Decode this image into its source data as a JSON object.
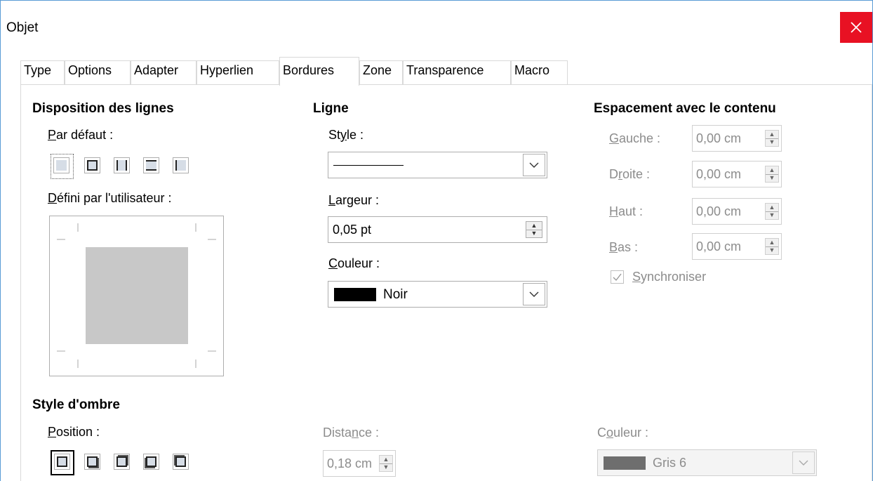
{
  "window": {
    "title": "Objet"
  },
  "tabs": [
    {
      "label": "Type",
      "active": false
    },
    {
      "label": "Options",
      "active": false
    },
    {
      "label": "Adapter",
      "active": false
    },
    {
      "label": "Hyperlien",
      "active": false
    },
    {
      "label": "Bordures",
      "active": true
    },
    {
      "label": "Zone",
      "active": false
    },
    {
      "label": "Transparence",
      "active": false
    },
    {
      "label": "Macro",
      "active": false
    }
  ],
  "line_arrangement": {
    "heading": "Disposition des lignes",
    "presets_label_key": "P",
    "presets_label_rest": "ar défaut :",
    "user_label_key": "D",
    "user_label_rest": "éfini par l'utilisateur :"
  },
  "line": {
    "heading": "Ligne",
    "style_label_pre": "St",
    "style_label_key": "y",
    "style_label_post": "le :",
    "width_label_key": "L",
    "width_label_rest": "argeur :",
    "width_value": "0,05 pt",
    "color_label_key": "C",
    "color_label_rest": "ouleur :",
    "color_value": "Noir",
    "color_swatch": "#000000"
  },
  "padding": {
    "heading": "Espacement avec le contenu",
    "left_label_key": "G",
    "left_label_rest": "auche :",
    "left_value": "0,00 cm",
    "right_label_pre": "D",
    "right_label_key": "r",
    "right_label_post": "oite :",
    "right_value": "0,00 cm",
    "top_label_key": "H",
    "top_label_rest": "aut :",
    "top_value": "0,00 cm",
    "bottom_label_key": "B",
    "bottom_label_rest": "as :",
    "bottom_value": "0,00 cm",
    "sync_label_key": "S",
    "sync_label_rest": "ynchroniser",
    "sync_checked": true
  },
  "shadow": {
    "heading": "Style d'ombre",
    "position_label_key": "P",
    "position_label_rest": "osition :",
    "distance_label_pre": "Dista",
    "distance_label_key": "n",
    "distance_label_post": "ce :",
    "distance_value": "0,18 cm",
    "color_label_pre": "C",
    "color_label_key": "o",
    "color_label_post": "uleur :",
    "color_value": "Gris 6",
    "color_swatch": "#6e6e6e"
  },
  "colors": {
    "accent": "#5a9bd5",
    "close": "#e81123",
    "disabled_text": "#8c8c8c"
  }
}
